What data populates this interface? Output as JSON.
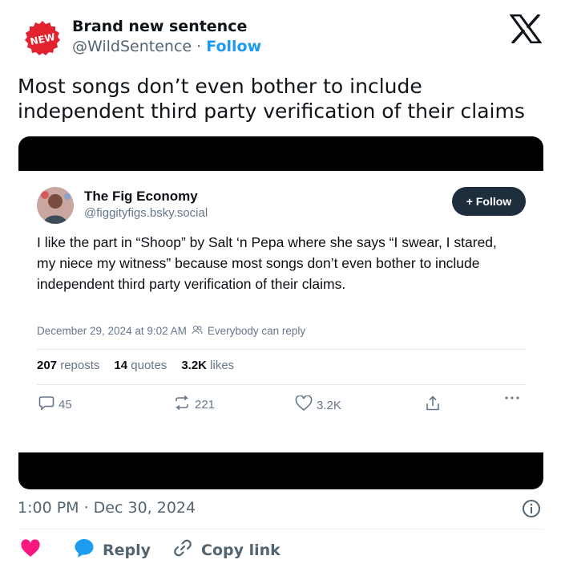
{
  "header": {
    "badge": "NEW",
    "display_name": "Brand new sentence",
    "handle": "@WildSentence",
    "separator": "·",
    "follow_label": "Follow"
  },
  "tweet": {
    "text": "Most songs don’t even bother to include independent third party verification of their claims"
  },
  "embedded_post": {
    "display_name": "The Fig Economy",
    "handle": "@figgityfigs.bsky.social",
    "follow_label": "+ Follow",
    "text": "I like the part in “Shoop” by Salt ‘n Pepa where she says “I swear, I stared, my niece my witness” because most songs don’t even bother to include independent third party verification of their claims.",
    "date": "December 29, 2024 at 9:02 AM",
    "reply_setting": "Everybody can reply",
    "stats": {
      "reposts_count": "207",
      "reposts_label": "reposts",
      "quotes_count": "14",
      "quotes_label": "quotes",
      "likes_count": "3.2K",
      "likes_label": "likes"
    },
    "actions": {
      "replies": "45",
      "reposts": "221",
      "likes": "3.2K"
    },
    "icons": [
      "reply-icon",
      "repost-icon",
      "like-icon",
      "share-icon",
      "more-icon"
    ]
  },
  "footer": {
    "timestamp": "1:00 PM · Dec 30, 2024",
    "reply_label": "Reply",
    "copy_link_label": "Copy link"
  },
  "colors": {
    "accent": "#1d9bf0",
    "heart": "#f91880",
    "badge_red": "#e0232e",
    "text_primary": "#0f1419",
    "text_secondary": "#536471"
  }
}
